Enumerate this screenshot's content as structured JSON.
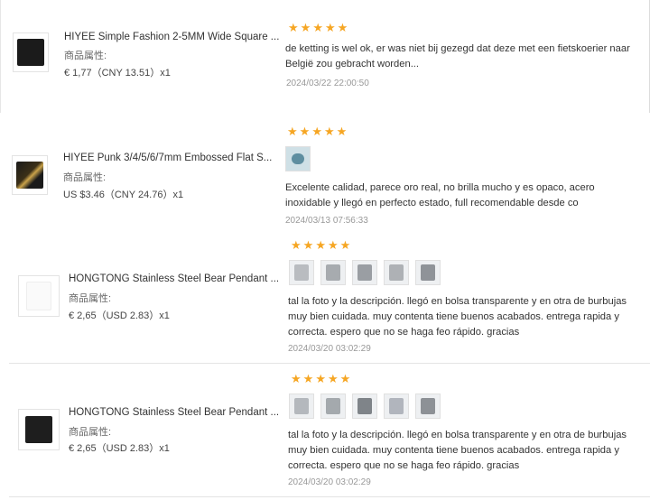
{
  "colors": {
    "star": "#f6a623",
    "text_primary": "#333333",
    "text_muted": "#999999"
  },
  "reviews": [
    {
      "product": {
        "name": "HIYEE Simple Fashion 2-5MM Wide Square ...",
        "attr_label": "商品属性:",
        "price": "€ 1,77（CNY  13.51）x1",
        "thumb_icon": "necklace-image"
      },
      "rating": 5,
      "text": "de ketting is wel ok, er was niet bij gezegd dat deze met een fietskoerier naar België zou gebracht worden...",
      "date": "2024/03/22 22:00:50",
      "photos": []
    },
    {
      "product": {
        "name": "HIYEE Punk 3/4/5/6/7mm Embossed Flat S...",
        "attr_label": "商品属性:",
        "price": "US $3.46（CNY  24.76）x1",
        "thumb_icon": "gold-chain-image"
      },
      "rating": 5,
      "text": "Excelente calidad, parece oro real, no brilla mucho y es opaco, acero inoxidable y llegó en perfecto estado, full recomendable desde co",
      "date": "2024/03/13 07:56:33",
      "photos": [
        "photo-1"
      ]
    },
    {
      "product": {
        "name": "HONGTONG Stainless Steel Bear Pendant ...",
        "attr_label": "商品属性:",
        "price": "€ 2,65（USD  2.83）x1",
        "thumb_icon": "bear-pendant-image"
      },
      "rating": 5,
      "text": "tal la foto y la descripción. llegó en bolsa transparente y en otra de burbujas muy bien cuidada. muy contenta tiene buenos acabados. entrega rapida y correcta. espero que no se haga feo rápido. gracias",
      "date": "2024/03/20 03:02:29",
      "photos": [
        "photo-1",
        "photo-2",
        "photo-3",
        "photo-4",
        "photo-5"
      ]
    },
    {
      "product": {
        "name": "HONGTONG Stainless Steel Bear Pendant ...",
        "attr_label": "商品属性:",
        "price": "€ 2,65（USD  2.83）x1",
        "thumb_icon": "bear-pendant-image"
      },
      "rating": 5,
      "text": "tal la foto y la descripción. llegó en bolsa transparente y en otra de burbujas muy bien cuidada. muy contenta tiene buenos acabados. entrega rapida y correcta. espero que no se haga feo rápido. gracias",
      "date": "2024/03/20 03:02:29",
      "photos": [
        "photo-1",
        "photo-2",
        "photo-3",
        "photo-4",
        "photo-5"
      ]
    }
  ]
}
